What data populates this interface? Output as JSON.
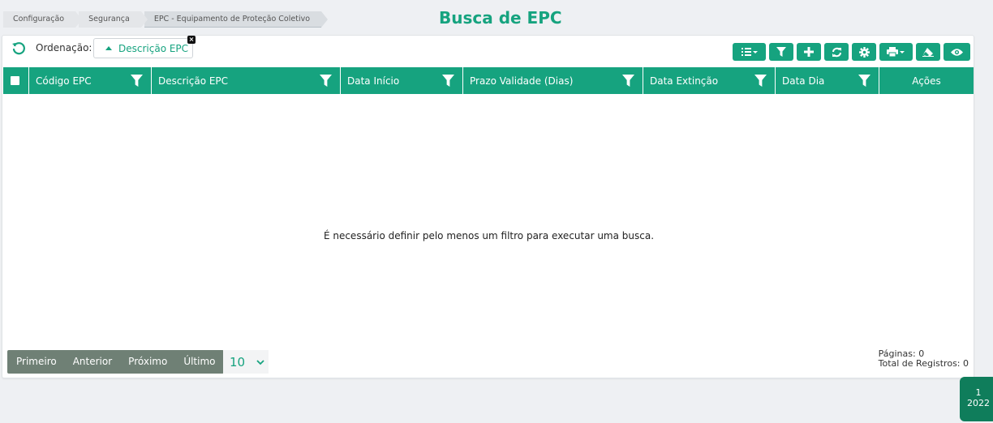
{
  "breadcrumb": [
    "Configuração",
    "Segurança",
    "EPC - Equipamento de Proteção Coletivo"
  ],
  "page_title": "Busca de EPC",
  "ordering": {
    "label": "Ordenação:",
    "value": "Descrição EPC",
    "close_glyph": "×"
  },
  "toolbar": {
    "buttons": [
      "columns-menu-icon",
      "filter-icon",
      "add-icon",
      "refresh-icon",
      "settings-icon",
      "print-icon",
      "eraser-icon",
      "eye-icon"
    ]
  },
  "table": {
    "columns": [
      {
        "label": "Código EPC",
        "filter": true
      },
      {
        "label": "Descrição EPC",
        "filter": true
      },
      {
        "label": "Data Início",
        "filter": true
      },
      {
        "label": "Prazo Validade (Dias)",
        "filter": true
      },
      {
        "label": "Data Extinção",
        "filter": true
      },
      {
        "label": "Data Dia",
        "filter": true
      },
      {
        "label": "Ações",
        "filter": false
      }
    ],
    "empty_message": "É necessário definir pelo menos um filtro para executar uma busca."
  },
  "pagination": {
    "first": "Primeiro",
    "previous": "Anterior",
    "next": "Próximo",
    "last": "Último",
    "page_size": "10"
  },
  "stats": {
    "pages": "Páginas: 0",
    "total": "Total de Registros: 0"
  },
  "badge": {
    "line1": "1",
    "line2": "2022"
  },
  "colors": {
    "accent": "#16a37f",
    "pager": "#6f8075",
    "badge": "#0f7d5b"
  }
}
